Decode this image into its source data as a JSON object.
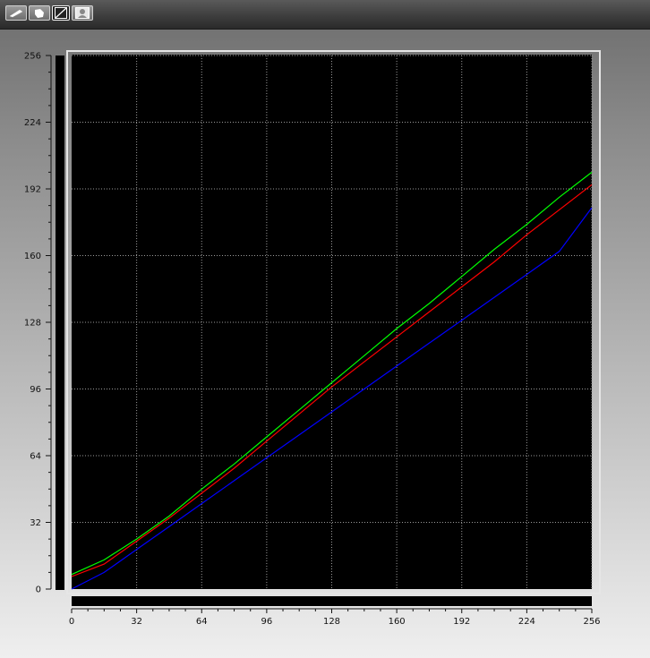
{
  "toolbar": {
    "buttons": [
      {
        "name": "curve-tool-button",
        "icon": "pencil-icon"
      },
      {
        "name": "pointer-tool-button",
        "icon": "hand-icon"
      },
      {
        "name": "linear-tool-button",
        "icon": "diagonal-line-icon"
      },
      {
        "name": "image-tool-button",
        "icon": "picture-icon"
      }
    ]
  },
  "chart_data": {
    "type": "line",
    "xlim": [
      0,
      256
    ],
    "ylim": [
      0,
      256
    ],
    "x_ticks": [
      0,
      32,
      64,
      96,
      128,
      160,
      192,
      224,
      256
    ],
    "y_ticks": [
      0,
      32,
      64,
      96,
      128,
      160,
      192,
      224,
      256
    ],
    "grid": true,
    "background": "#000000",
    "series": [
      {
        "color": "#00ff00",
        "x": [
          0,
          16,
          32,
          48,
          64,
          80,
          96,
          112,
          128,
          144,
          160,
          176,
          192,
          208,
          224,
          240,
          256
        ],
        "y": [
          7,
          14,
          24,
          35,
          48,
          60,
          73,
          86,
          99,
          112,
          125,
          137,
          150,
          163,
          175,
          188,
          200
        ]
      },
      {
        "color": "#ff0000",
        "x": [
          0,
          16,
          32,
          48,
          64,
          80,
          96,
          112,
          128,
          144,
          160,
          176,
          192,
          208,
          224,
          240,
          256
        ],
        "y": [
          6,
          12,
          23,
          34,
          46,
          58,
          71,
          84,
          97,
          109,
          121,
          133,
          145,
          157,
          170,
          182,
          194
        ]
      },
      {
        "color": "#0000ff",
        "x": [
          0,
          16,
          32,
          48,
          64,
          80,
          96,
          112,
          128,
          144,
          160,
          176,
          192,
          208,
          224,
          240,
          256
        ],
        "y": [
          0,
          8,
          19,
          30,
          41,
          52,
          63,
          74,
          85,
          96,
          107,
          118,
          129,
          140,
          151,
          162,
          183
        ]
      }
    ]
  }
}
